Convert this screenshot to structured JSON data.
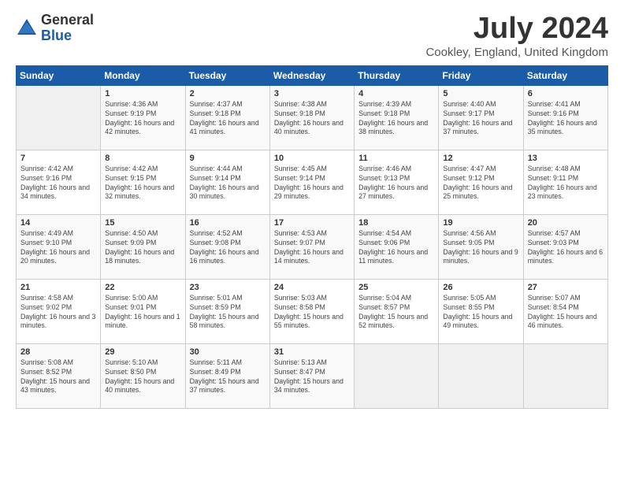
{
  "header": {
    "logo_general": "General",
    "logo_blue": "Blue",
    "title": "July 2024",
    "location": "Cookley, England, United Kingdom"
  },
  "weekdays": [
    "Sunday",
    "Monday",
    "Tuesday",
    "Wednesday",
    "Thursday",
    "Friday",
    "Saturday"
  ],
  "weeks": [
    [
      {
        "day": "",
        "sunrise": "",
        "sunset": "",
        "daylight": ""
      },
      {
        "day": "1",
        "sunrise": "Sunrise: 4:36 AM",
        "sunset": "Sunset: 9:19 PM",
        "daylight": "Daylight: 16 hours and 42 minutes."
      },
      {
        "day": "2",
        "sunrise": "Sunrise: 4:37 AM",
        "sunset": "Sunset: 9:18 PM",
        "daylight": "Daylight: 16 hours and 41 minutes."
      },
      {
        "day": "3",
        "sunrise": "Sunrise: 4:38 AM",
        "sunset": "Sunset: 9:18 PM",
        "daylight": "Daylight: 16 hours and 40 minutes."
      },
      {
        "day": "4",
        "sunrise": "Sunrise: 4:39 AM",
        "sunset": "Sunset: 9:18 PM",
        "daylight": "Daylight: 16 hours and 38 minutes."
      },
      {
        "day": "5",
        "sunrise": "Sunrise: 4:40 AM",
        "sunset": "Sunset: 9:17 PM",
        "daylight": "Daylight: 16 hours and 37 minutes."
      },
      {
        "day": "6",
        "sunrise": "Sunrise: 4:41 AM",
        "sunset": "Sunset: 9:16 PM",
        "daylight": "Daylight: 16 hours and 35 minutes."
      }
    ],
    [
      {
        "day": "7",
        "sunrise": "Sunrise: 4:42 AM",
        "sunset": "Sunset: 9:16 PM",
        "daylight": "Daylight: 16 hours and 34 minutes."
      },
      {
        "day": "8",
        "sunrise": "Sunrise: 4:42 AM",
        "sunset": "Sunset: 9:15 PM",
        "daylight": "Daylight: 16 hours and 32 minutes."
      },
      {
        "day": "9",
        "sunrise": "Sunrise: 4:44 AM",
        "sunset": "Sunset: 9:14 PM",
        "daylight": "Daylight: 16 hours and 30 minutes."
      },
      {
        "day": "10",
        "sunrise": "Sunrise: 4:45 AM",
        "sunset": "Sunset: 9:14 PM",
        "daylight": "Daylight: 16 hours and 29 minutes."
      },
      {
        "day": "11",
        "sunrise": "Sunrise: 4:46 AM",
        "sunset": "Sunset: 9:13 PM",
        "daylight": "Daylight: 16 hours and 27 minutes."
      },
      {
        "day": "12",
        "sunrise": "Sunrise: 4:47 AM",
        "sunset": "Sunset: 9:12 PM",
        "daylight": "Daylight: 16 hours and 25 minutes."
      },
      {
        "day": "13",
        "sunrise": "Sunrise: 4:48 AM",
        "sunset": "Sunset: 9:11 PM",
        "daylight": "Daylight: 16 hours and 23 minutes."
      }
    ],
    [
      {
        "day": "14",
        "sunrise": "Sunrise: 4:49 AM",
        "sunset": "Sunset: 9:10 PM",
        "daylight": "Daylight: 16 hours and 20 minutes."
      },
      {
        "day": "15",
        "sunrise": "Sunrise: 4:50 AM",
        "sunset": "Sunset: 9:09 PM",
        "daylight": "Daylight: 16 hours and 18 minutes."
      },
      {
        "day": "16",
        "sunrise": "Sunrise: 4:52 AM",
        "sunset": "Sunset: 9:08 PM",
        "daylight": "Daylight: 16 hours and 16 minutes."
      },
      {
        "day": "17",
        "sunrise": "Sunrise: 4:53 AM",
        "sunset": "Sunset: 9:07 PM",
        "daylight": "Daylight: 16 hours and 14 minutes."
      },
      {
        "day": "18",
        "sunrise": "Sunrise: 4:54 AM",
        "sunset": "Sunset: 9:06 PM",
        "daylight": "Daylight: 16 hours and 11 minutes."
      },
      {
        "day": "19",
        "sunrise": "Sunrise: 4:56 AM",
        "sunset": "Sunset: 9:05 PM",
        "daylight": "Daylight: 16 hours and 9 minutes."
      },
      {
        "day": "20",
        "sunrise": "Sunrise: 4:57 AM",
        "sunset": "Sunset: 9:03 PM",
        "daylight": "Daylight: 16 hours and 6 minutes."
      }
    ],
    [
      {
        "day": "21",
        "sunrise": "Sunrise: 4:58 AM",
        "sunset": "Sunset: 9:02 PM",
        "daylight": "Daylight: 16 hours and 3 minutes."
      },
      {
        "day": "22",
        "sunrise": "Sunrise: 5:00 AM",
        "sunset": "Sunset: 9:01 PM",
        "daylight": "Daylight: 16 hours and 1 minute."
      },
      {
        "day": "23",
        "sunrise": "Sunrise: 5:01 AM",
        "sunset": "Sunset: 8:59 PM",
        "daylight": "Daylight: 15 hours and 58 minutes."
      },
      {
        "day": "24",
        "sunrise": "Sunrise: 5:03 AM",
        "sunset": "Sunset: 8:58 PM",
        "daylight": "Daylight: 15 hours and 55 minutes."
      },
      {
        "day": "25",
        "sunrise": "Sunrise: 5:04 AM",
        "sunset": "Sunset: 8:57 PM",
        "daylight": "Daylight: 15 hours and 52 minutes."
      },
      {
        "day": "26",
        "sunrise": "Sunrise: 5:05 AM",
        "sunset": "Sunset: 8:55 PM",
        "daylight": "Daylight: 15 hours and 49 minutes."
      },
      {
        "day": "27",
        "sunrise": "Sunrise: 5:07 AM",
        "sunset": "Sunset: 8:54 PM",
        "daylight": "Daylight: 15 hours and 46 minutes."
      }
    ],
    [
      {
        "day": "28",
        "sunrise": "Sunrise: 5:08 AM",
        "sunset": "Sunset: 8:52 PM",
        "daylight": "Daylight: 15 hours and 43 minutes."
      },
      {
        "day": "29",
        "sunrise": "Sunrise: 5:10 AM",
        "sunset": "Sunset: 8:50 PM",
        "daylight": "Daylight: 15 hours and 40 minutes."
      },
      {
        "day": "30",
        "sunrise": "Sunrise: 5:11 AM",
        "sunset": "Sunset: 8:49 PM",
        "daylight": "Daylight: 15 hours and 37 minutes."
      },
      {
        "day": "31",
        "sunrise": "Sunrise: 5:13 AM",
        "sunset": "Sunset: 8:47 PM",
        "daylight": "Daylight: 15 hours and 34 minutes."
      },
      {
        "day": "",
        "sunrise": "",
        "sunset": "",
        "daylight": ""
      },
      {
        "day": "",
        "sunrise": "",
        "sunset": "",
        "daylight": ""
      },
      {
        "day": "",
        "sunrise": "",
        "sunset": "",
        "daylight": ""
      }
    ]
  ]
}
